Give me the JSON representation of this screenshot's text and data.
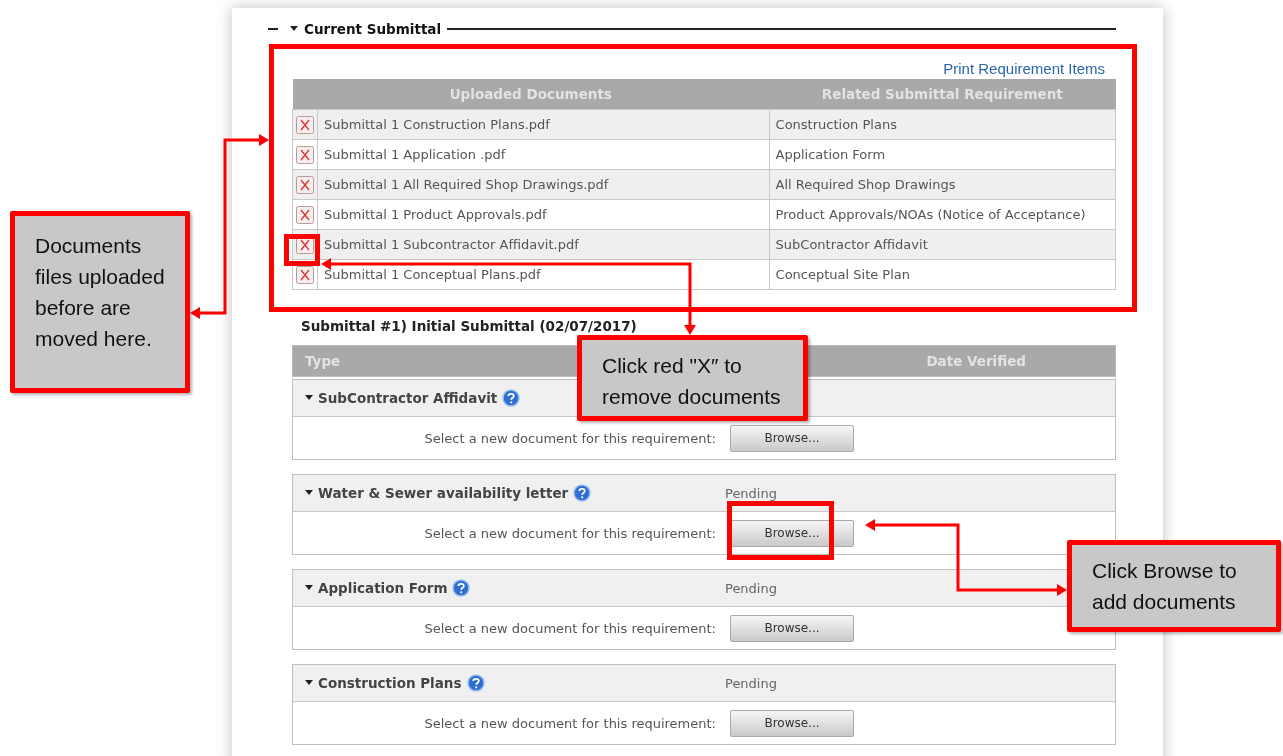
{
  "section_title": "Current Submittal",
  "print_link": "Print Requirement Items",
  "documents_table": {
    "columns": [
      "Uploaded Documents",
      "Related Submittal Requirement"
    ],
    "rows": [
      {
        "file": "Submittal 1 Construction Plans.pdf",
        "requirement": "Construction Plans"
      },
      {
        "file": "Submittal 1 Application .pdf",
        "requirement": "Application Form"
      },
      {
        "file": "Submittal 1 All Required Shop Drawings.pdf",
        "requirement": "All Required Shop Drawings"
      },
      {
        "file": "Submittal 1 Product Approvals.pdf",
        "requirement": "Product Approvals/NOAs (Notice of Acceptance)"
      },
      {
        "file": "Submittal 1 Subcontractor Affidavit.pdf",
        "requirement": "SubContractor Affidavit"
      },
      {
        "file": "Submittal 1 Conceptual Plans.pdf",
        "requirement": "Conceptual Site Plan"
      }
    ]
  },
  "submittal": {
    "title": "Submittal #1) Initial Submittal (02/07/2017)",
    "columns": [
      "Type",
      "Date Verified"
    ],
    "requirements": [
      {
        "name": "SubContractor Affidavit",
        "expanded": true,
        "prompt": "Select a new document for this requirement:",
        "button": "Browse..."
      },
      {
        "name": "Water & Sewer availability letter",
        "expanded": true,
        "status": "Pending",
        "prompt": "Select a new document for this requirement:",
        "button": "Browse..."
      },
      {
        "name": "Application Form",
        "expanded": true,
        "status": "Pending",
        "prompt": "Select a new document for this requirement:",
        "button": "Browse..."
      },
      {
        "name": "Construction Plans",
        "expanded": true,
        "status": "Pending",
        "prompt": "Select a new document for this requirement:",
        "button": "Browse..."
      }
    ]
  },
  "callouts": [
    {
      "text": "Documents files uploaded before are moved here."
    },
    {
      "text": "Click red \"X″ to remove documents"
    },
    {
      "text": "Click Browse to add documents"
    }
  ]
}
